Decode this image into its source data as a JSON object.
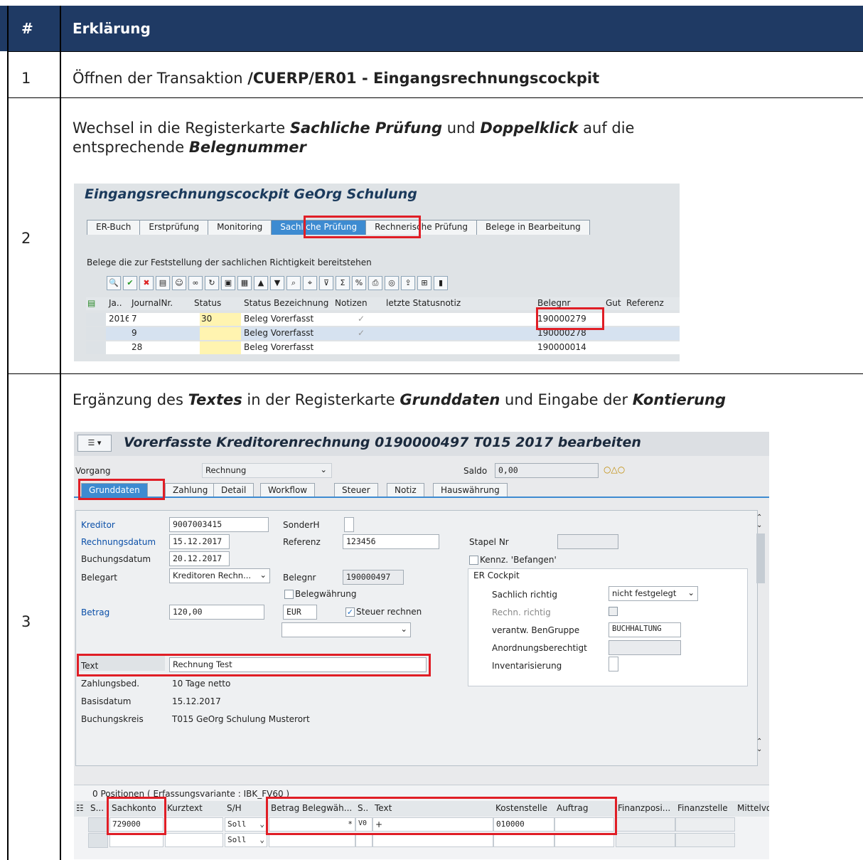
{
  "table": {
    "header_num": "#",
    "header_expl": "Erklärung",
    "rows": [
      {
        "num": "1",
        "text_plain": "Öffnen der Transaktion ",
        "text_bold": "/CUERP/ER01 - Eingangsrechnungscockpit"
      },
      {
        "num": "2",
        "t1": "Wechsel in die Registerkarte ",
        "t2": "Sachliche Prüfung",
        "t3": " und ",
        "t4": "Doppelklick",
        "t5": " auf die",
        "t6": "entsprechende ",
        "t7": "Belegnummer"
      },
      {
        "num": "3",
        "t1": "Ergänzung des ",
        "t2": "Textes",
        "t3": " in der Registerkarte ",
        "t4": "Grunddaten",
        "t5": " und Eingabe der ",
        "t6": "Kontierung"
      }
    ]
  },
  "screen1": {
    "title": "Eingangsrechnungscockpit GeOrg Schulung",
    "tabs": [
      "ER-Buch",
      "Erstprüfung",
      "Monitoring",
      "Sachliche Prüfung",
      "Rechnerische Prüfung",
      "Belege in Bearbeitung"
    ],
    "info": "Belege die zur Feststellung der sachlichen Richtigkeit bereitstehen",
    "columns": [
      "Ja..",
      "JournalNr.",
      "Status",
      "Status Bezeichnung",
      "Notizen",
      "letzte Statusnotiz",
      "Belegnr",
      "Gut",
      "Referenz"
    ],
    "rows": [
      {
        "ja": "2016",
        "journal": "7",
        "status": "30",
        "bez": "Beleg Vorerfasst",
        "notiz": "✓",
        "belegnr": "190000279"
      },
      {
        "ja": "",
        "journal": "9",
        "status": "",
        "bez": "Beleg Vorerfasst",
        "notiz": "✓",
        "belegnr": "190000278"
      },
      {
        "ja": "",
        "journal": "28",
        "status": "",
        "bez": "Beleg Vorerfasst",
        "notiz": "",
        "belegnr": "190000014"
      }
    ]
  },
  "screen2": {
    "title": "Vorerfasste Kreditorenrechnung 0190000497 T015 2017 bearbeiten",
    "vorgang_label": "Vorgang",
    "vorgang_value": "Rechnung",
    "saldo_label": "Saldo",
    "saldo_value": "0,00",
    "tabs": [
      "Grunddaten",
      "Zahlung",
      "Detail",
      "Workflow",
      "Steuer",
      "Notiz",
      "Hauswährung"
    ],
    "kreditor_label": "Kreditor",
    "kreditor_value": "9007003415",
    "sonderh_label": "SonderH",
    "rdatum_label": "Rechnungsdatum",
    "rdatum_value": "15.12.2017",
    "referenz_label": "Referenz",
    "referenz_value": "123456",
    "stapel_label": "Stapel Nr",
    "bdatum_label": "Buchungsdatum",
    "bdatum_value": "20.12.2017",
    "kennz_label": "Kennz. 'Befangen'",
    "belegart_label": "Belegart",
    "belegart_value": "Kreditoren Rechn...",
    "belegnr_label": "Belegnr",
    "belegnr_value": "190000497",
    "ercockpit_label": "ER Cockpit",
    "belegwaehrung_label": "Belegwährung",
    "sachlich_label": "Sachlich richtig",
    "sachlich_value": "nicht festgelegt",
    "betrag_label": "Betrag",
    "betrag_value": "120,00",
    "waehrung_value": "EUR",
    "steuer_label": "Steuer rechnen",
    "rechn_label": "Rechn. richtig",
    "verantw_label": "verantw. BenGruppe",
    "verantw_value": "BUCHHALTUNG",
    "anord_label": "Anordnungsberechtigt",
    "inventar_label": "Inventarisierung",
    "text_label": "Text",
    "text_value": "Rechnung Test",
    "zahlungsbed_label": "Zahlungsbed.",
    "zahlungsbed_value": "10 Tage netto",
    "basisdatum_label": "Basisdatum",
    "basisdatum_value": "15.12.2017",
    "bukrs_label": "Buchungskreis",
    "bukrs_value": "T015 GeOrg Schulung Musterort",
    "positionen": "0 Positionen ( Erfassungsvariante : IBK_FV60 )",
    "columns": [
      "S...",
      "Sachkonto",
      "Kurztext",
      "S/H",
      "Betrag Belegwäh...",
      "S..",
      "Text",
      "Kostenstelle",
      "Auftrag",
      "Finanzposi...",
      "Finanzstelle",
      "Mittelvo"
    ],
    "rows": [
      {
        "sachkonto": "729000",
        "sh": "Soll",
        "betrag": "*",
        "s": "V0",
        "text": "+",
        "kostenstelle": "010000"
      },
      {
        "sachkonto": "",
        "sh": "Soll",
        "betrag": "",
        "s": "",
        "text": "",
        "kostenstelle": ""
      }
    ]
  }
}
